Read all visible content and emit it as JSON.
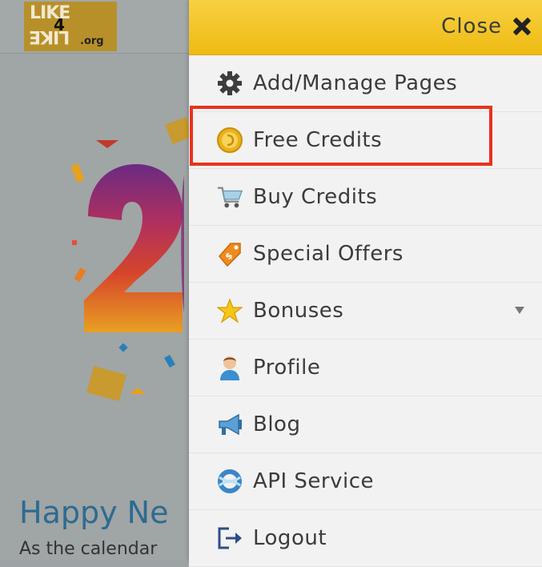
{
  "logo": {
    "top_text": "LIKE",
    "number": "4",
    "bottom_text": "LIKE",
    "suffix": ".org"
  },
  "background": {
    "heading": "Happy Ne",
    "subtext": "As the calendar"
  },
  "menu": {
    "close_label": "Close",
    "items": [
      {
        "label": "Add/Manage Pages",
        "icon": "gear-icon"
      },
      {
        "label": "Free Credits",
        "icon": "coin-icon"
      },
      {
        "label": "Buy Credits",
        "icon": "cart-icon"
      },
      {
        "label": "Special Offers",
        "icon": "price-tag-icon"
      },
      {
        "label": "Bonuses",
        "icon": "star-icon",
        "has_submenu": true
      },
      {
        "label": "Profile",
        "icon": "user-icon"
      },
      {
        "label": "Blog",
        "icon": "megaphone-icon"
      },
      {
        "label": "API Service",
        "icon": "api-globe-icon"
      },
      {
        "label": "Logout",
        "icon": "logout-icon"
      }
    ],
    "highlighted_item": "Free Credits"
  },
  "colors": {
    "header_yellow": "#f3c628",
    "highlight_red": "#e8321e",
    "menu_bg": "#f1f1f1",
    "text": "#3b3b3b"
  }
}
